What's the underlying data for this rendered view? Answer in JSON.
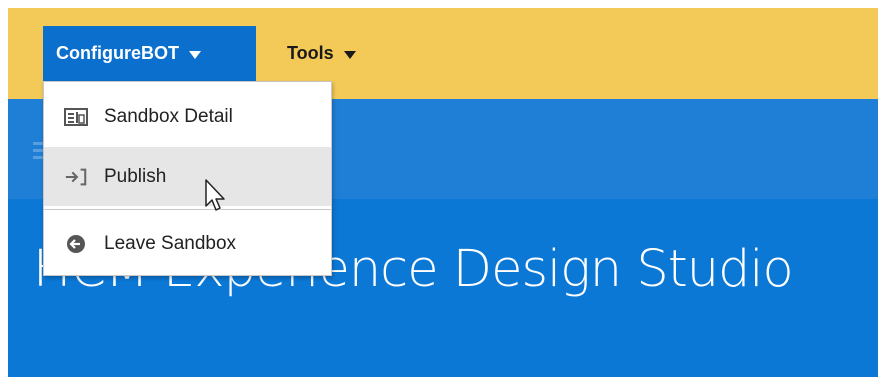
{
  "sandbox_bar": {
    "configure_menu": "ConfigureBOT",
    "tools_menu": "Tools"
  },
  "dropdown": {
    "items": [
      {
        "label": "Sandbox Detail",
        "icon": "sandbox-detail-icon"
      },
      {
        "label": "Publish",
        "icon": "publish-icon",
        "state": "hovered"
      },
      {
        "label": "Leave Sandbox",
        "icon": "leave-sandbox-icon"
      }
    ]
  },
  "page": {
    "title": "HCM Experience Design Studio"
  },
  "colors": {
    "sandbox_bar": "#f3ca57",
    "menu_button_active": "#0b6fcd",
    "header_blue": "#1f7fd6",
    "page_blue": "#0b78d6",
    "hover_bg": "#e6e6e6"
  }
}
